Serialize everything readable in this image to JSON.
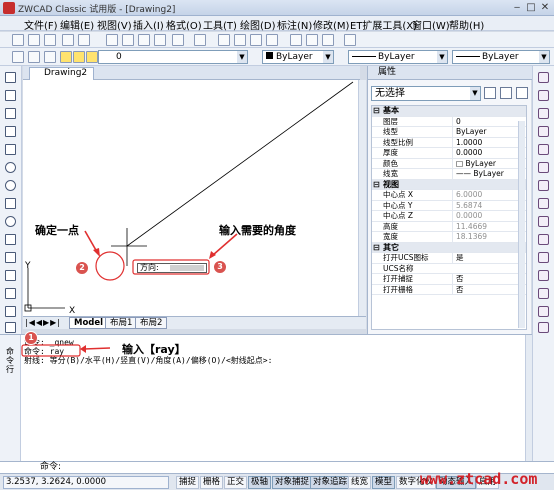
{
  "window": {
    "title": "ZWCAD Classic 试用版 - [Drawing2]",
    "controls": [
      "‒",
      "□",
      "✕"
    ]
  },
  "menu": [
    "文件(F)",
    "编辑(E)",
    "视图(V)",
    "插入(I)",
    "格式(O)",
    "工具(T)",
    "绘图(D)",
    "标注(N)",
    "修改(M)",
    "ET扩展工具(X)",
    "窗口(W)",
    "帮助(H)"
  ],
  "toolbar": {
    "layer_value": "0",
    "color_value": "ByLayer",
    "linetype_value": "ByLayer",
    "lineweight_value": "ByLayer"
  },
  "drawing": {
    "tab_name": "Drawing2",
    "axis_y": "Y",
    "axis_x": "X",
    "direction_label": "方向:",
    "layout_tabs": [
      "Model",
      "布局1",
      "布局2"
    ]
  },
  "properties": {
    "header": "属性",
    "selection": "无选择",
    "rows": [
      {
        "type": "cat",
        "key": "基本"
      },
      {
        "key": "图层",
        "value": "0"
      },
      {
        "key": "线型",
        "value": "ByLayer"
      },
      {
        "key": "线型比例",
        "value": "1.0000"
      },
      {
        "key": "厚度",
        "value": "0.0000"
      },
      {
        "key": "颜色",
        "value": "□ ByLayer"
      },
      {
        "key": "线宽",
        "value": "—— ByLayer"
      },
      {
        "type": "cat",
        "key": "视图"
      },
      {
        "key": "中心点 X",
        "value": "6.0000",
        "gray": true
      },
      {
        "key": "中心点 Y",
        "value": "5.6874",
        "gray": true
      },
      {
        "key": "中心点 Z",
        "value": "0.0000",
        "gray": true
      },
      {
        "key": "高度",
        "value": "11.4669",
        "gray": true
      },
      {
        "key": "宽度",
        "value": "18.1369",
        "gray": true
      },
      {
        "type": "cat",
        "key": "其它"
      },
      {
        "key": "打开UCS图标",
        "value": "是"
      },
      {
        "key": "UCS名称",
        "value": ""
      },
      {
        "key": "打开捕捉",
        "value": "否"
      },
      {
        "key": "打开栅格",
        "value": "否"
      }
    ]
  },
  "command": {
    "lines": [
      "命令: _qnew",
      "命令: ray",
      "射线: 等分(B)/水平(H)/竖直(V)/角度(A)/偏移(O)/<射线起点>:"
    ],
    "prompt": "命令:",
    "side_label": "命令行"
  },
  "status": {
    "coords": "3.2537,  3.2624,  0.0000",
    "buttons": [
      "捕捉",
      "栅格",
      "正交",
      "极轴",
      "对象捕捉",
      "对象追踪",
      "线宽",
      "模型",
      "数字化仪",
      "动态输入",
      "启用"
    ]
  },
  "annotations": {
    "pick_point": "确定一点",
    "enter_angle": "输入需要的角度",
    "enter_ray": "输入【ray】",
    "n1": "1",
    "n2": "2",
    "n3": "3",
    "watermark": "www.ztcad.com"
  },
  "colors": {
    "callout_red": "#d9534f",
    "highlight_red": "#e03030"
  }
}
